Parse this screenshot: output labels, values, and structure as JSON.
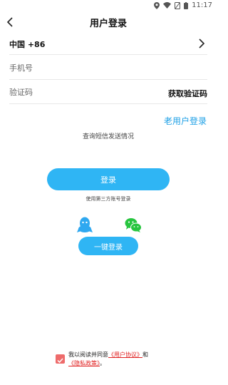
{
  "status": {
    "time": "11:17"
  },
  "header": {
    "title": "用户登录"
  },
  "country": {
    "label": "中国 +86"
  },
  "phone": {
    "placeholder": "手机号"
  },
  "code": {
    "placeholder": "验证码",
    "get_code_label": "获取验证码"
  },
  "links": {
    "old_user": "老用户登录",
    "query_sms": "查询短信发送情况"
  },
  "login": {
    "label": "登录",
    "third_party": "使用第三方账号登录"
  },
  "one_key": {
    "label": "一键登录"
  },
  "agreement": {
    "prefix": "我以阅读并同意",
    "user_agreement": "《用户协议》",
    "and": "和",
    "privacy_policy": "《隐私政策》",
    "suffix": "。",
    "checked": true
  },
  "colors": {
    "accent": "#2fb5f4",
    "link_blue": "#1ea0e6",
    "check_red": "#ee6b6b",
    "link_red": "#e02020"
  }
}
